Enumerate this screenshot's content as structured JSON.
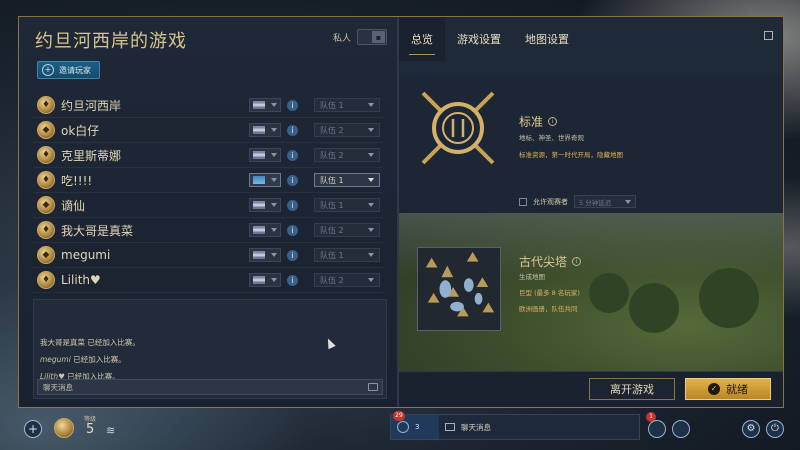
{
  "lobby": {
    "title": "约旦河西岸的游戏",
    "private_label": "私人",
    "invite_label": "邀请玩家"
  },
  "players": [
    {
      "name": "约旦河西岸",
      "team": "队伍 1",
      "active": false
    },
    {
      "name": "ok白仔",
      "team": "队伍 2",
      "active": false
    },
    {
      "name": "克里斯蒂娜",
      "team": "队伍 2",
      "active": false
    },
    {
      "name": "吃!!!!",
      "team": "队伍 1",
      "active": true
    },
    {
      "name": "谪仙",
      "team": "队伍 1",
      "active": false
    },
    {
      "name": "我大哥是真菜",
      "team": "队伍 2",
      "active": false
    },
    {
      "name": "megumi",
      "team": "队伍 1",
      "active": false
    },
    {
      "name": "Lilith♥",
      "team": "队伍 2",
      "active": false
    }
  ],
  "chat": {
    "messages": [
      {
        "prefix": "我大哥是真菜",
        "text": " 已经加入比赛。"
      },
      {
        "prefix": "megumi",
        "text": " 已经加入比赛。"
      },
      {
        "prefix": "Lilith♥",
        "text": " 已经加入比赛。"
      }
    ],
    "input_placeholder": "聊天消息"
  },
  "tabs": [
    {
      "label": "总览",
      "active": true
    },
    {
      "label": "游戏设置",
      "active": false
    },
    {
      "label": "地图设置",
      "active": false
    }
  ],
  "mode": {
    "title": "标准",
    "subtitle": "地标、神圣、世界奇观",
    "description": "标准资源，第一时代开局，隐藏地图",
    "spectators_label": "允许观赛者",
    "spectators_value": "5 分钟延迟"
  },
  "map": {
    "title": "古代尖塔",
    "subtitle": "生成地图",
    "size": "巨型 (最多 8 名玩家)",
    "resources": "欧洲画册，队伍共同"
  },
  "buttons": {
    "leave": "离开游戏",
    "ready": "就绪"
  },
  "footer": {
    "level_label": "等级",
    "level_value": "5",
    "friends_badge": "29",
    "friends_count": "3",
    "chat_tab_label": "聊天消息",
    "notif_badge": "1"
  },
  "colors": {
    "accent_gold": "#d9c58d",
    "ready_gold": "#e2b24a",
    "panel_bg": "#1f2836",
    "badge_red": "#c7322a"
  }
}
